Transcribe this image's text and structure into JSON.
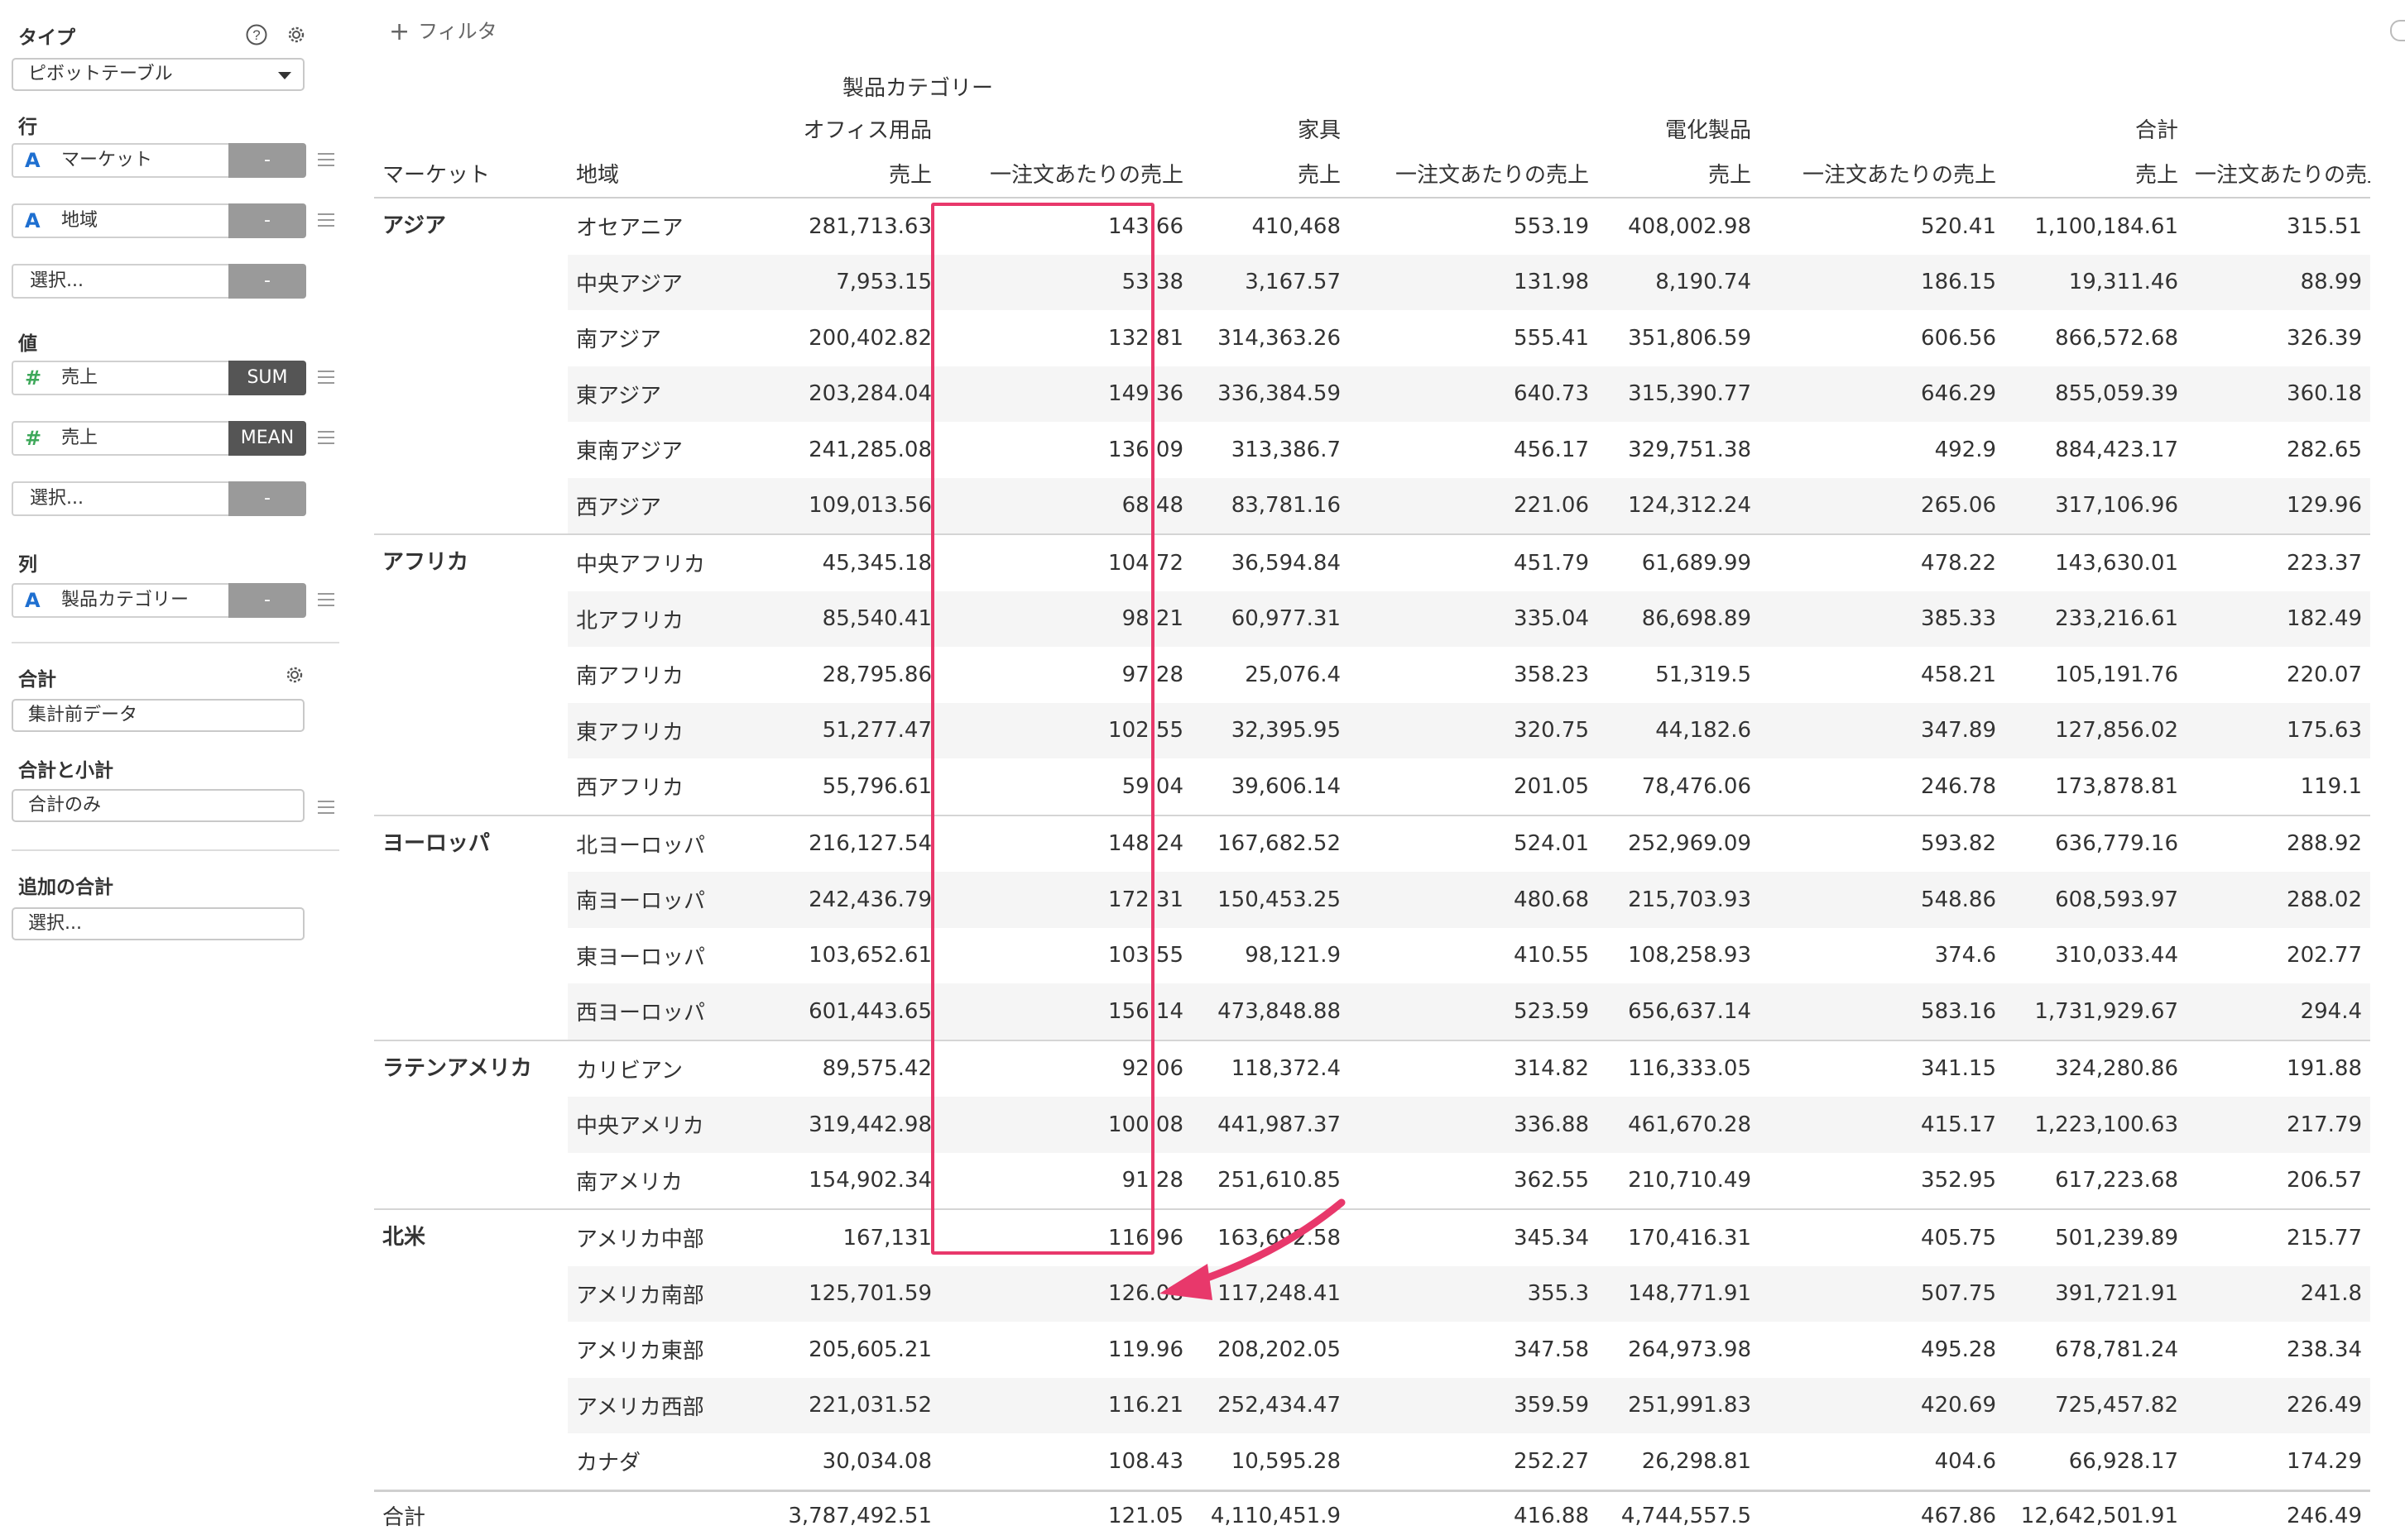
{
  "sidebar": {
    "type_label": "タイプ",
    "type_value": "ピボットテーブル",
    "rows_label": "行",
    "rows": [
      {
        "icon": "A",
        "name": "マーケット",
        "agg": "-"
      },
      {
        "icon": "A",
        "name": "地域",
        "agg": "-"
      },
      {
        "icon": "",
        "name": "選択...",
        "agg": "-"
      }
    ],
    "values_label": "値",
    "values": [
      {
        "icon": "#",
        "name": "売上",
        "agg": "SUM"
      },
      {
        "icon": "#",
        "name": "売上",
        "agg": "MEAN"
      },
      {
        "icon": "",
        "name": "選択...",
        "agg": "-"
      }
    ],
    "columns_label": "列",
    "columns": [
      {
        "icon": "A",
        "name": "製品カテゴリー",
        "agg": "-"
      }
    ],
    "total_label": "合計",
    "total_value": "集計前データ",
    "subtotal_label": "合計と小計",
    "subtotal_value": "合計のみ",
    "extra_total_label": "追加の合計",
    "extra_total_value": "選択..."
  },
  "toolbar": {
    "filter_label": "フィルタ",
    "filter_icon": "plus-icon"
  },
  "pivot": {
    "column_dimension": "製品カテゴリー",
    "categories": [
      "オフィス用品",
      "家具",
      "電化製品",
      "合計"
    ],
    "row_headers": [
      "マーケット",
      "地域"
    ],
    "measure_headers": [
      "売上",
      "一注文あたりの売上"
    ],
    "rows": [
      {
        "market": "アジア",
        "region": "オセアニア",
        "v": [
          "281,713.63",
          "143.66",
          "410,468",
          "553.19",
          "408,002.98",
          "520.41",
          "1,100,184.61",
          "315.51"
        ]
      },
      {
        "market": "",
        "region": "中央アジア",
        "v": [
          "7,953.15",
          "53.38",
          "3,167.57",
          "131.98",
          "8,190.74",
          "186.15",
          "19,311.46",
          "88.99"
        ]
      },
      {
        "market": "",
        "region": "南アジア",
        "v": [
          "200,402.82",
          "132.81",
          "314,363.26",
          "555.41",
          "351,806.59",
          "606.56",
          "866,572.68",
          "326.39"
        ]
      },
      {
        "market": "",
        "region": "東アジア",
        "v": [
          "203,284.04",
          "149.36",
          "336,384.59",
          "640.73",
          "315,390.77",
          "646.29",
          "855,059.39",
          "360.18"
        ]
      },
      {
        "market": "",
        "region": "東南アジア",
        "v": [
          "241,285.08",
          "136.09",
          "313,386.7",
          "456.17",
          "329,751.38",
          "492.9",
          "884,423.17",
          "282.65"
        ]
      },
      {
        "market": "",
        "region": "西アジア",
        "v": [
          "109,013.56",
          "68.48",
          "83,781.16",
          "221.06",
          "124,312.24",
          "265.06",
          "317,106.96",
          "129.96"
        ]
      },
      {
        "market": "アフリカ",
        "region": "中央アフリカ",
        "v": [
          "45,345.18",
          "104.72",
          "36,594.84",
          "451.79",
          "61,689.99",
          "478.22",
          "143,630.01",
          "223.37"
        ]
      },
      {
        "market": "",
        "region": "北アフリカ",
        "v": [
          "85,540.41",
          "98.21",
          "60,977.31",
          "335.04",
          "86,698.89",
          "385.33",
          "233,216.61",
          "182.49"
        ]
      },
      {
        "market": "",
        "region": "南アフリカ",
        "v": [
          "28,795.86",
          "97.28",
          "25,076.4",
          "358.23",
          "51,319.5",
          "458.21",
          "105,191.76",
          "220.07"
        ]
      },
      {
        "market": "",
        "region": "東アフリカ",
        "v": [
          "51,277.47",
          "102.55",
          "32,395.95",
          "320.75",
          "44,182.6",
          "347.89",
          "127,856.02",
          "175.63"
        ]
      },
      {
        "market": "",
        "region": "西アフリカ",
        "v": [
          "55,796.61",
          "59.04",
          "39,606.14",
          "201.05",
          "78,476.06",
          "246.78",
          "173,878.81",
          "119.1"
        ]
      },
      {
        "market": "ヨーロッパ",
        "region": "北ヨーロッパ",
        "v": [
          "216,127.54",
          "148.24",
          "167,682.52",
          "524.01",
          "252,969.09",
          "593.82",
          "636,779.16",
          "288.92"
        ]
      },
      {
        "market": "",
        "region": "南ヨーロッパ",
        "v": [
          "242,436.79",
          "172.31",
          "150,453.25",
          "480.68",
          "215,703.93",
          "548.86",
          "608,593.97",
          "288.02"
        ]
      },
      {
        "market": "",
        "region": "東ヨーロッパ",
        "v": [
          "103,652.61",
          "103.55",
          "98,121.9",
          "410.55",
          "108,258.93",
          "374.6",
          "310,033.44",
          "202.77"
        ]
      },
      {
        "market": "",
        "region": "西ヨーロッパ",
        "v": [
          "601,443.65",
          "156.14",
          "473,848.88",
          "523.59",
          "656,637.14",
          "583.16",
          "1,731,929.67",
          "294.4"
        ]
      },
      {
        "market": "ラテンアメリカ",
        "region": "カリビアン",
        "v": [
          "89,575.42",
          "92.06",
          "118,372.4",
          "314.82",
          "116,333.05",
          "341.15",
          "324,280.86",
          "191.88"
        ]
      },
      {
        "market": "",
        "region": "中央アメリカ",
        "v": [
          "319,442.98",
          "100.08",
          "441,987.37",
          "336.88",
          "461,670.28",
          "415.17",
          "1,223,100.63",
          "217.79"
        ]
      },
      {
        "market": "",
        "region": "南アメリカ",
        "v": [
          "154,902.34",
          "91.28",
          "251,610.85",
          "362.55",
          "210,710.49",
          "352.95",
          "617,223.68",
          "206.57"
        ]
      },
      {
        "market": "北米",
        "region": "アメリカ中部",
        "v": [
          "167,131",
          "116.96",
          "163,692.58",
          "345.34",
          "170,416.31",
          "405.75",
          "501,239.89",
          "215.77"
        ]
      },
      {
        "market": "",
        "region": "アメリカ南部",
        "v": [
          "125,701.59",
          "126.08",
          "117,248.41",
          "355.3",
          "148,771.91",
          "507.75",
          "391,721.91",
          "241.8"
        ]
      },
      {
        "market": "",
        "region": "アメリカ東部",
        "v": [
          "205,605.21",
          "119.96",
          "208,202.05",
          "347.58",
          "264,973.98",
          "495.28",
          "678,781.24",
          "238.34"
        ]
      },
      {
        "market": "",
        "region": "アメリカ西部",
        "v": [
          "221,031.52",
          "116.21",
          "252,434.47",
          "359.59",
          "251,991.83",
          "420.69",
          "725,457.82",
          "226.49"
        ]
      },
      {
        "market": "",
        "region": "カナダ",
        "v": [
          "30,034.08",
          "108.43",
          "10,595.28",
          "252.27",
          "26,298.81",
          "404.6",
          "66,928.17",
          "174.29"
        ]
      }
    ],
    "total": {
      "label": "合計",
      "v": [
        "3,787,492.51",
        "121.05",
        "4,110,451.9",
        "416.88",
        "4,744,557.5",
        "467.86",
        "12,642,501.91",
        "246.49"
      ]
    }
  },
  "annotation": {
    "highlight_color": "#e8386b"
  }
}
